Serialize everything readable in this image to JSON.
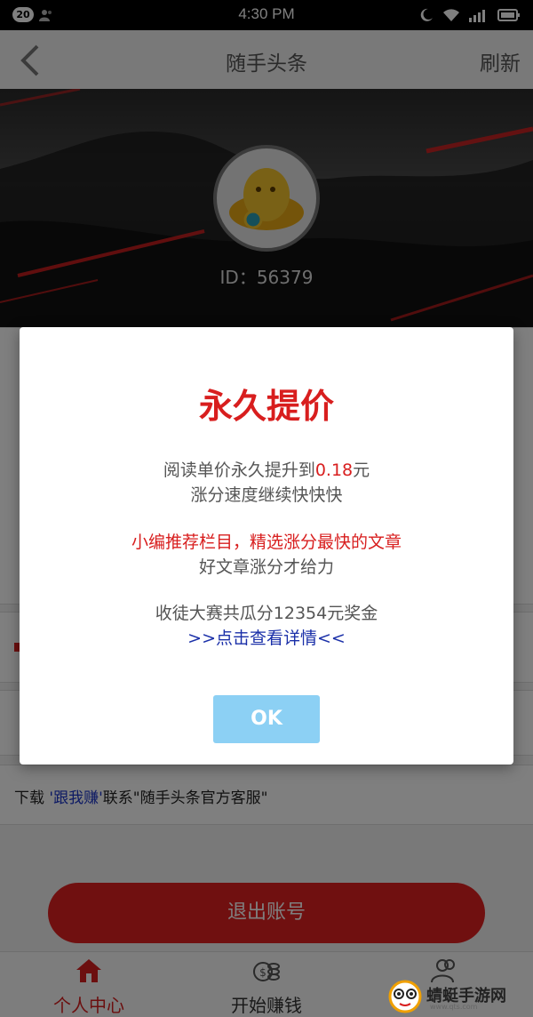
{
  "status_bar": {
    "notification_count": "20",
    "time": "4:30 PM"
  },
  "header": {
    "title": "随手头条",
    "refresh_label": "刷新"
  },
  "profile": {
    "id_text": "ID：56379"
  },
  "list": {
    "download_prefix": "下载 ",
    "download_highlight": "'跟我赚'",
    "download_suffix": "联系\"随手头条官方客服\""
  },
  "logout_label": "退出账号",
  "tabs": [
    {
      "label": "个人中心",
      "icon": "home-icon",
      "active": true
    },
    {
      "label": "开始赚钱",
      "icon": "coins-icon",
      "active": false
    },
    {
      "label": "",
      "icon": "users-icon",
      "active": false
    }
  ],
  "watermark": {
    "text": "蜻蜓手游网",
    "url": "www.qts.com"
  },
  "dialog": {
    "title": "永久提价",
    "line1_prefix": "阅读单价永久提升到",
    "line1_value": "0.18",
    "line1_suffix": "元",
    "line2": "涨分速度继续快快快",
    "line3": "小编推荐栏目，精选涨分最快的文章",
    "line4": "好文章涨分才给力",
    "line5": "收徒大赛共瓜分12354元奖金",
    "link": ">>点击查看详情<<",
    "ok_label": "OK"
  },
  "colors": {
    "accent_red": "#d81e1e",
    "ok_blue": "#8cd0f4",
    "link_blue": "#1a2fa8"
  }
}
